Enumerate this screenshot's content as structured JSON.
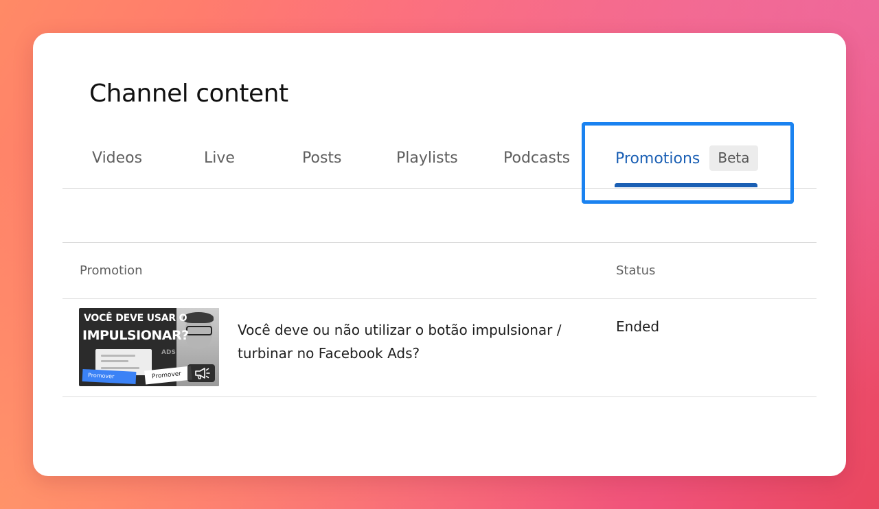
{
  "page": {
    "title": "Channel content"
  },
  "tabs": [
    {
      "label": "Videos"
    },
    {
      "label": "Live"
    },
    {
      "label": "Posts"
    },
    {
      "label": "Playlists"
    },
    {
      "label": "Podcasts"
    },
    {
      "label": "Promotions",
      "badge": "Beta",
      "active": true
    }
  ],
  "table": {
    "columns": [
      "Promotion",
      "Status"
    ],
    "rows": [
      {
        "title": "Você deve ou não utilizar o botão impulsionar / turbinar no Facebook Ads?",
        "status": "Ended",
        "thumbnail": {
          "line1": "VOCÊ DEVE USAR O",
          "line2": "IMPULSIONAR?",
          "button_blue": "Promover",
          "button_white": "Promover",
          "ads_text": "ADS",
          "badge_icon": "megaphone-icon"
        }
      }
    ]
  },
  "colors": {
    "accent": "#1a5fb4",
    "highlight": "#1a82f0",
    "card": "#ffffff"
  }
}
